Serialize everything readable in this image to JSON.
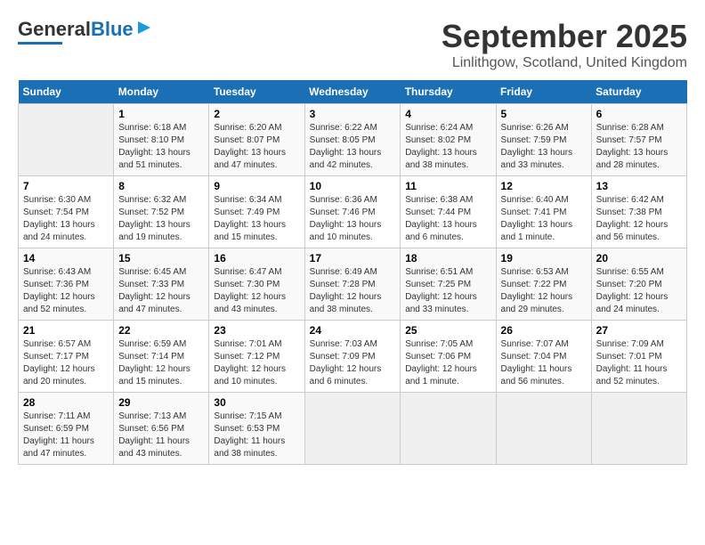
{
  "header": {
    "logo_general": "General",
    "logo_blue": "Blue",
    "title": "September 2025",
    "location": "Linlithgow, Scotland, United Kingdom"
  },
  "calendar": {
    "days_of_week": [
      "Sunday",
      "Monday",
      "Tuesday",
      "Wednesday",
      "Thursday",
      "Friday",
      "Saturday"
    ],
    "weeks": [
      [
        {
          "day": "",
          "sunrise": "",
          "sunset": "",
          "daylight": ""
        },
        {
          "day": "1",
          "sunrise": "Sunrise: 6:18 AM",
          "sunset": "Sunset: 8:10 PM",
          "daylight": "Daylight: 13 hours and 51 minutes."
        },
        {
          "day": "2",
          "sunrise": "Sunrise: 6:20 AM",
          "sunset": "Sunset: 8:07 PM",
          "daylight": "Daylight: 13 hours and 47 minutes."
        },
        {
          "day": "3",
          "sunrise": "Sunrise: 6:22 AM",
          "sunset": "Sunset: 8:05 PM",
          "daylight": "Daylight: 13 hours and 42 minutes."
        },
        {
          "day": "4",
          "sunrise": "Sunrise: 6:24 AM",
          "sunset": "Sunset: 8:02 PM",
          "daylight": "Daylight: 13 hours and 38 minutes."
        },
        {
          "day": "5",
          "sunrise": "Sunrise: 6:26 AM",
          "sunset": "Sunset: 7:59 PM",
          "daylight": "Daylight: 13 hours and 33 minutes."
        },
        {
          "day": "6",
          "sunrise": "Sunrise: 6:28 AM",
          "sunset": "Sunset: 7:57 PM",
          "daylight": "Daylight: 13 hours and 28 minutes."
        }
      ],
      [
        {
          "day": "7",
          "sunrise": "Sunrise: 6:30 AM",
          "sunset": "Sunset: 7:54 PM",
          "daylight": "Daylight: 13 hours and 24 minutes."
        },
        {
          "day": "8",
          "sunrise": "Sunrise: 6:32 AM",
          "sunset": "Sunset: 7:52 PM",
          "daylight": "Daylight: 13 hours and 19 minutes."
        },
        {
          "day": "9",
          "sunrise": "Sunrise: 6:34 AM",
          "sunset": "Sunset: 7:49 PM",
          "daylight": "Daylight: 13 hours and 15 minutes."
        },
        {
          "day": "10",
          "sunrise": "Sunrise: 6:36 AM",
          "sunset": "Sunset: 7:46 PM",
          "daylight": "Daylight: 13 hours and 10 minutes."
        },
        {
          "day": "11",
          "sunrise": "Sunrise: 6:38 AM",
          "sunset": "Sunset: 7:44 PM",
          "daylight": "Daylight: 13 hours and 6 minutes."
        },
        {
          "day": "12",
          "sunrise": "Sunrise: 6:40 AM",
          "sunset": "Sunset: 7:41 PM",
          "daylight": "Daylight: 13 hours and 1 minute."
        },
        {
          "day": "13",
          "sunrise": "Sunrise: 6:42 AM",
          "sunset": "Sunset: 7:38 PM",
          "daylight": "Daylight: 12 hours and 56 minutes."
        }
      ],
      [
        {
          "day": "14",
          "sunrise": "Sunrise: 6:43 AM",
          "sunset": "Sunset: 7:36 PM",
          "daylight": "Daylight: 12 hours and 52 minutes."
        },
        {
          "day": "15",
          "sunrise": "Sunrise: 6:45 AM",
          "sunset": "Sunset: 7:33 PM",
          "daylight": "Daylight: 12 hours and 47 minutes."
        },
        {
          "day": "16",
          "sunrise": "Sunrise: 6:47 AM",
          "sunset": "Sunset: 7:30 PM",
          "daylight": "Daylight: 12 hours and 43 minutes."
        },
        {
          "day": "17",
          "sunrise": "Sunrise: 6:49 AM",
          "sunset": "Sunset: 7:28 PM",
          "daylight": "Daylight: 12 hours and 38 minutes."
        },
        {
          "day": "18",
          "sunrise": "Sunrise: 6:51 AM",
          "sunset": "Sunset: 7:25 PM",
          "daylight": "Daylight: 12 hours and 33 minutes."
        },
        {
          "day": "19",
          "sunrise": "Sunrise: 6:53 AM",
          "sunset": "Sunset: 7:22 PM",
          "daylight": "Daylight: 12 hours and 29 minutes."
        },
        {
          "day": "20",
          "sunrise": "Sunrise: 6:55 AM",
          "sunset": "Sunset: 7:20 PM",
          "daylight": "Daylight: 12 hours and 24 minutes."
        }
      ],
      [
        {
          "day": "21",
          "sunrise": "Sunrise: 6:57 AM",
          "sunset": "Sunset: 7:17 PM",
          "daylight": "Daylight: 12 hours and 20 minutes."
        },
        {
          "day": "22",
          "sunrise": "Sunrise: 6:59 AM",
          "sunset": "Sunset: 7:14 PM",
          "daylight": "Daylight: 12 hours and 15 minutes."
        },
        {
          "day": "23",
          "sunrise": "Sunrise: 7:01 AM",
          "sunset": "Sunset: 7:12 PM",
          "daylight": "Daylight: 12 hours and 10 minutes."
        },
        {
          "day": "24",
          "sunrise": "Sunrise: 7:03 AM",
          "sunset": "Sunset: 7:09 PM",
          "daylight": "Daylight: 12 hours and 6 minutes."
        },
        {
          "day": "25",
          "sunrise": "Sunrise: 7:05 AM",
          "sunset": "Sunset: 7:06 PM",
          "daylight": "Daylight: 12 hours and 1 minute."
        },
        {
          "day": "26",
          "sunrise": "Sunrise: 7:07 AM",
          "sunset": "Sunset: 7:04 PM",
          "daylight": "Daylight: 11 hours and 56 minutes."
        },
        {
          "day": "27",
          "sunrise": "Sunrise: 7:09 AM",
          "sunset": "Sunset: 7:01 PM",
          "daylight": "Daylight: 11 hours and 52 minutes."
        }
      ],
      [
        {
          "day": "28",
          "sunrise": "Sunrise: 7:11 AM",
          "sunset": "Sunset: 6:59 PM",
          "daylight": "Daylight: 11 hours and 47 minutes."
        },
        {
          "day": "29",
          "sunrise": "Sunrise: 7:13 AM",
          "sunset": "Sunset: 6:56 PM",
          "daylight": "Daylight: 11 hours and 43 minutes."
        },
        {
          "day": "30",
          "sunrise": "Sunrise: 7:15 AM",
          "sunset": "Sunset: 6:53 PM",
          "daylight": "Daylight: 11 hours and 38 minutes."
        },
        {
          "day": "",
          "sunrise": "",
          "sunset": "",
          "daylight": ""
        },
        {
          "day": "",
          "sunrise": "",
          "sunset": "",
          "daylight": ""
        },
        {
          "day": "",
          "sunrise": "",
          "sunset": "",
          "daylight": ""
        },
        {
          "day": "",
          "sunrise": "",
          "sunset": "",
          "daylight": ""
        }
      ]
    ]
  }
}
